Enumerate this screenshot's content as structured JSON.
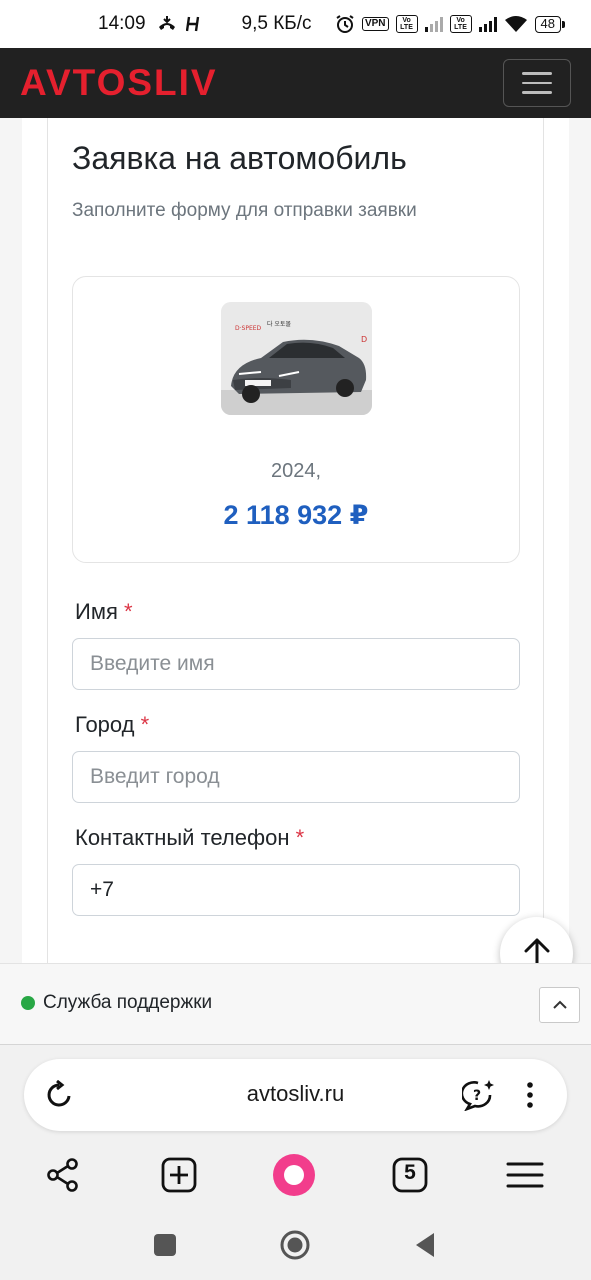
{
  "status_bar": {
    "time": "14:09",
    "network_speed": "9,5 КБ/с",
    "vpn_badge": "VPN",
    "volte_badge": "Vo LTE",
    "battery": "48"
  },
  "site": {
    "logo_text": "AVTOSLIV"
  },
  "form": {
    "title": "Заявка на автомобиль",
    "subtitle": "Заполните форму для отправки заявки",
    "car": {
      "year": "2024,",
      "price": "2 118 932 ₽"
    },
    "name_label": "Имя",
    "name_placeholder": "Введите имя",
    "city_label": "Город",
    "city_placeholder": "Введит город",
    "phone_label": "Контактный телефон",
    "phone_value": "+7",
    "required_mark": "*"
  },
  "support": {
    "label": "Служба поддержки",
    "status_color": "#28a745"
  },
  "browser": {
    "url": "avtosliv.ru",
    "tabs_count": "5"
  },
  "colors": {
    "logo": "#e5202e",
    "price": "#1f5fbf",
    "header_bg": "#212121"
  }
}
